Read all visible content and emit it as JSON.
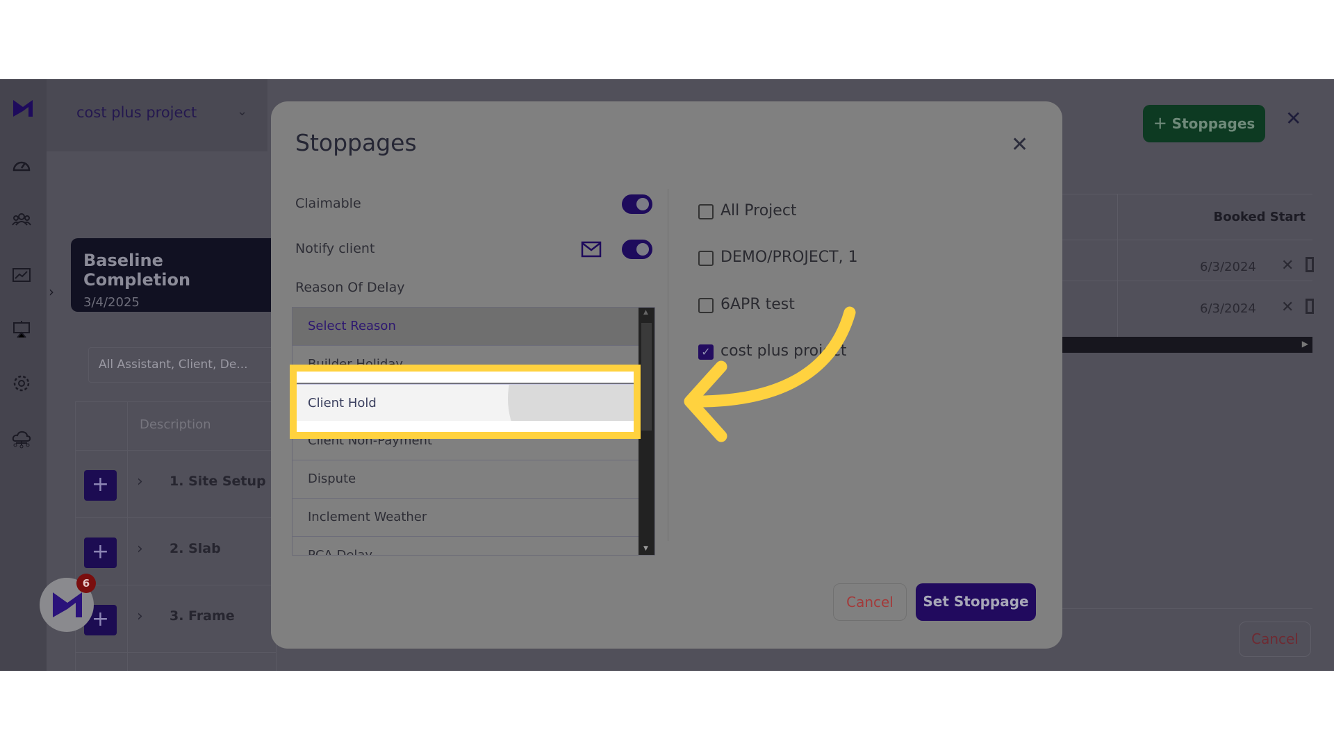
{
  "sidebar": {
    "icons": [
      "logo-icon",
      "dashboard-gauge-icon",
      "users-group-icon",
      "chart-icon",
      "presentation-icon",
      "gear-icon",
      "cloud-network-icon"
    ]
  },
  "header": {
    "project": "cost plus project"
  },
  "baseline": {
    "title": "Baseline Completion",
    "date": "3/4/2025"
  },
  "filter": {
    "value": "All Assistant, Client, De..."
  },
  "table": {
    "header": "Description",
    "rows": [
      "1. Site Setup",
      "2. Slab",
      "3. Frame"
    ],
    "plus": "+"
  },
  "right": {
    "stoppages_button": "Stoppages",
    "booked_start_header": "Booked Start",
    "dates": [
      "6/3/2024",
      "6/3/2024"
    ],
    "cancel": "Cancel"
  },
  "chat": {
    "badge": "6"
  },
  "modal": {
    "title": "Stoppages",
    "claimable_label": "Claimable",
    "claimable_on": true,
    "notify_label": "Notify client",
    "notify_on": true,
    "reason_label": "Reason Of Delay",
    "reasons": [
      "Select Reason",
      "Builder Holiday",
      "Client Hold",
      "Client Non-Payment",
      "Dispute",
      "Inclement Weather",
      "PCA Delay"
    ],
    "highlighted_reason": "Client Hold",
    "projects": [
      {
        "label": "All Project",
        "checked": false
      },
      {
        "label": "DEMO/PROJECT, 1",
        "checked": false
      },
      {
        "label": "6APR test",
        "checked": false
      },
      {
        "label": "cost plus project",
        "checked": true
      }
    ],
    "cancel": "Cancel",
    "submit": "Set Stoppage"
  },
  "colors": {
    "accent": "#1e0b5c",
    "highlight": "#ffd23f",
    "stoppages_green": "#0d3a22",
    "cancel_red": "#a33a3a"
  }
}
